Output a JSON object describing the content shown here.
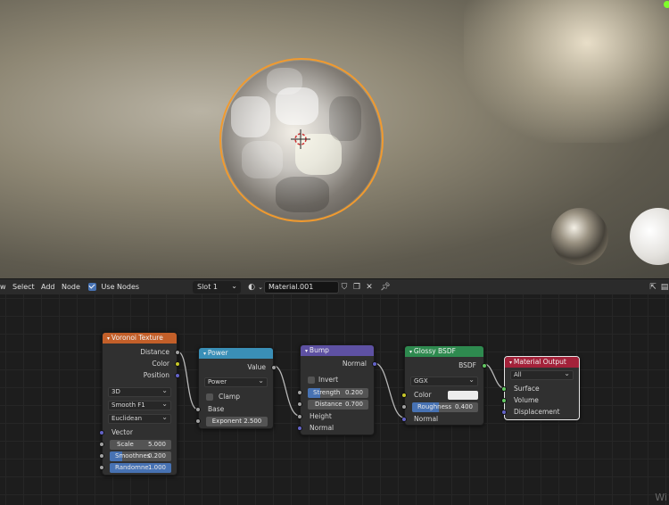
{
  "header": {
    "menu": [
      "w",
      "Select",
      "Add",
      "Node"
    ],
    "use_nodes_label": "Use Nodes",
    "slot": "Slot 1",
    "material_name": "Material.001"
  },
  "nodes": {
    "voronoi": {
      "title": "Voronoi Texture",
      "outputs": [
        "Distance",
        "Color",
        "Position"
      ],
      "dimensions": "3D",
      "feature": "Smooth F1",
      "metric": "Euclidean",
      "vector_label": "Vector",
      "scale_label": "Scale",
      "scale_value": "5.000",
      "smooth_label": "Smoothnes",
      "smooth_value": "0.200",
      "random_label": "Randomne",
      "random_value": "1.000"
    },
    "power": {
      "title": "Power",
      "output": "Value",
      "operation": "Power",
      "clamp_label": "Clamp",
      "base_label": "Base",
      "exponent_field": "Exponent 2.500"
    },
    "bump": {
      "title": "Bump",
      "output": "Normal",
      "invert_label": "Invert",
      "strength_label": "Strength",
      "strength_value": "0.200",
      "distance_label": "Distance",
      "distance_value": "0.700",
      "height_label": "Height",
      "normal_label": "Normal"
    },
    "glossy": {
      "title": "Glossy BSDF",
      "output": "BSDF",
      "distribution": "GGX",
      "color_label": "Color",
      "roughness_label": "Roughness",
      "roughness_value": "0.400",
      "normal_label": "Normal"
    },
    "output": {
      "title": "Material Output",
      "target": "All",
      "inputs": [
        "Surface",
        "Volume",
        "Displacement"
      ]
    }
  },
  "watermark": "Wi",
  "colors": {
    "texture_header": "#c35f29",
    "converter_header": "#3a8fb7",
    "vector_header": "#5e51a3",
    "shader_header": "#2e8a4f",
    "output_header": "#a3223a",
    "selection_outline": "#f19a2f",
    "socket_float": "#a1a1a1",
    "socket_color": "#c7c729",
    "socket_vector": "#6363c7",
    "socket_shader": "#63c763"
  }
}
